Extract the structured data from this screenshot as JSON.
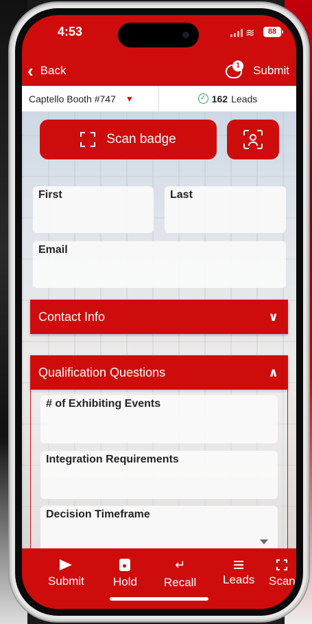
{
  "status_bar": {
    "time": "4:53",
    "battery": "88"
  },
  "nav": {
    "back_label": "Back",
    "submit_label": "Submit",
    "notification_count": "1"
  },
  "selector": {
    "booth": "Captello Booth #747",
    "leads_count": "162",
    "leads_label": "Leads"
  },
  "actions": {
    "scan_badge_label": "Scan badge"
  },
  "form": {
    "first_label": "First",
    "last_label": "Last",
    "email_label": "Email"
  },
  "sections": {
    "contact_info": "Contact Info",
    "qualification": "Qualification Questions"
  },
  "qualification_fields": [
    {
      "label": "# of Exhibiting Events"
    },
    {
      "label": "Integration Requirements"
    },
    {
      "label": "Decision Timeframe"
    }
  ],
  "tabbar": {
    "submit": "Submit",
    "hold": "Hold",
    "recall": "Recall",
    "leads": "Leads",
    "scan": "Scan"
  },
  "colors": {
    "brand_red": "#cf0c0c",
    "check_green": "#2aa44a"
  }
}
